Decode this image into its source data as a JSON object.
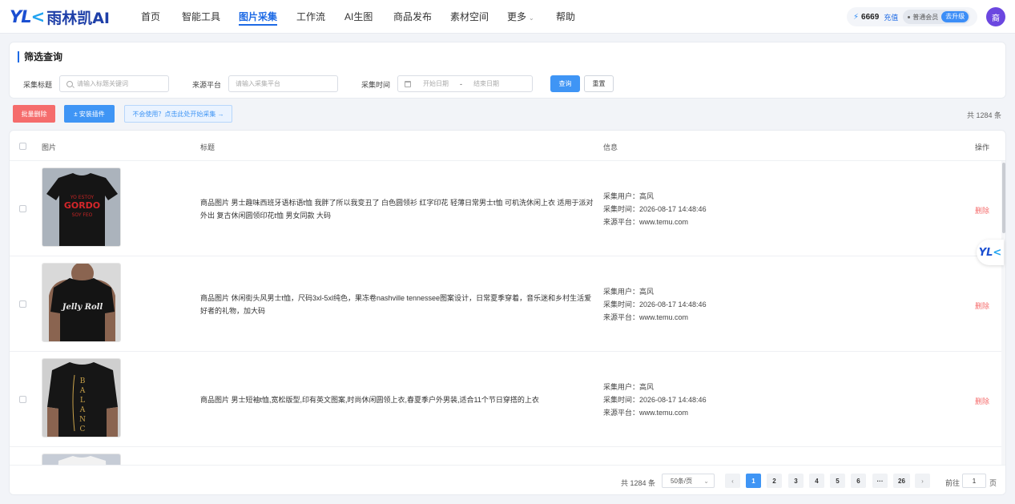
{
  "header": {
    "logo_mark": "YL",
    "logo_k": "<",
    "logo_text": "雨林凯AI",
    "nav": [
      "首页",
      "智能工具",
      "图片采集",
      "工作流",
      "AI生图",
      "商品发布",
      "素材空间",
      "更多",
      "帮助"
    ],
    "active_nav": "图片采集",
    "credits": "6669",
    "recharge": "充值",
    "member": "普通会员",
    "upgrade": "去升级",
    "avatar": "裔"
  },
  "filter": {
    "title": "筛选查询",
    "title_label": "采集标题",
    "title_placeholder": "请输入标题关键词",
    "platform_label": "来源平台",
    "platform_placeholder": "请输入采集平台",
    "time_label": "采集时间",
    "start_placeholder": "开始日期",
    "date_separator": "-",
    "end_placeholder": "结束日期",
    "query_button": "查询",
    "reset_button": "重置"
  },
  "toolbar": {
    "batch_delete": "批量删除",
    "install_plugin": "± 安装插件",
    "help_link": "不会使用？点击此处开始采集 →",
    "total": "共 1284 条"
  },
  "table": {
    "columns": [
      "图片",
      "标题",
      "信息",
      "操作"
    ],
    "rows": [
      {
        "title": "商品图片 男士趣味西班牙语标语t恤 我胖了所以我变丑了 白色圆领衫 红字印花 轻薄日常男士t恤 可机洗休闲上衣 适用于派对外出 复古休闲圆领印花t恤 男女同款 大码",
        "user": "采集用户：高风",
        "time": "采集时间：2026-08-17 14:48:46",
        "platform": "来源平台：www.temu.com",
        "action": "删除",
        "img_text_1": "GORDO",
        "img_text_2": "SOY FEO"
      },
      {
        "title": "商品图片 休闲街头风男士t恤，尺码3xl-5xl纯色，果冻卷nashville tennessee图案设计，日常夏季穿着，音乐迷和乡村生活爱好者的礼物，加大码",
        "user": "采集用户：高风",
        "time": "采集时间：2026-08-17 14:48:46",
        "platform": "来源平台：www.temu.com",
        "action": "删除",
        "img_text_1": "Jelly Roll"
      },
      {
        "title": "商品图片 男士短袖t恤,宽松版型,印有英文图案,时尚休闲圆领上衣,春夏季户外男装,适合11个节日穿搭的上衣",
        "user": "采集用户：高风",
        "time": "采集时间：2026-08-17 14:48:46",
        "platform": "来源平台：www.temu.com",
        "action": "删除",
        "img_text_1": "BALANCE"
      }
    ]
  },
  "pagination": {
    "total": "共 1284 条",
    "page_size": "50条/页",
    "pages": [
      "1",
      "2",
      "3",
      "4",
      "5",
      "6",
      "···",
      "26"
    ],
    "prev": "‹",
    "next": "›",
    "goto_label": "前往",
    "goto_value": "1",
    "page_suffix": "页"
  },
  "colors": {
    "primary": "#3f95f5",
    "danger": "#f56c6c",
    "brand": "#1b4fd1"
  }
}
